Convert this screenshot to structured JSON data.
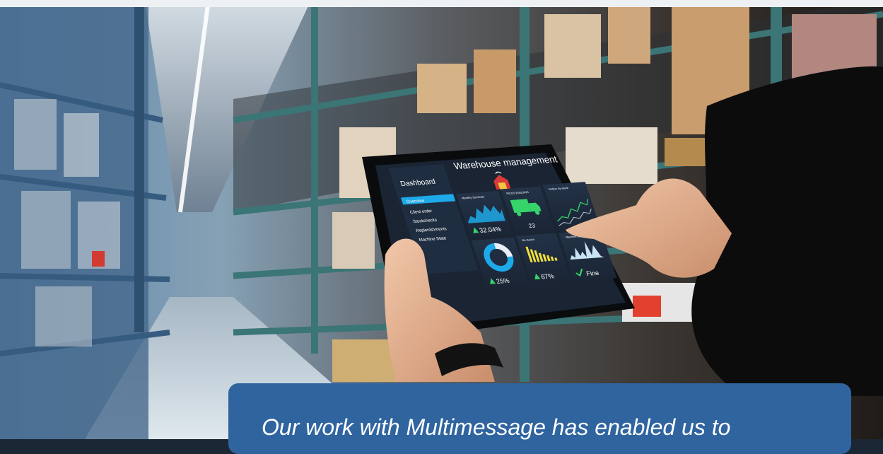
{
  "tablet": {
    "title": "Warehouse management",
    "sidebar_title": "Dashboard",
    "menu": [
      "Overview",
      "Client order",
      "Stockchecks",
      "Replenishments",
      "Machine State"
    ],
    "tiles": {
      "monthly_summary": {
        "label": "Monthly Summary",
        "value": "32.04%"
      },
      "deliveries": {
        "label": "PICKS ENSUING",
        "value": "23"
      },
      "orders": {
        "label": "Orders by week"
      },
      "donut": {
        "value": "25%",
        "fraction": 0.25
      },
      "bars": {
        "label": "No stocks",
        "value": "67%"
      },
      "machine": {
        "label": "Machine State",
        "value": "Fine"
      }
    }
  },
  "quote": {
    "text": "Our work with Multimessage has enabled us to"
  },
  "colors": {
    "card": "#2f649f",
    "screen": "#1a2433",
    "accent_cyan": "#1ea9e8",
    "accent_green": "#37d46b",
    "accent_yellow": "#f2e23a"
  }
}
